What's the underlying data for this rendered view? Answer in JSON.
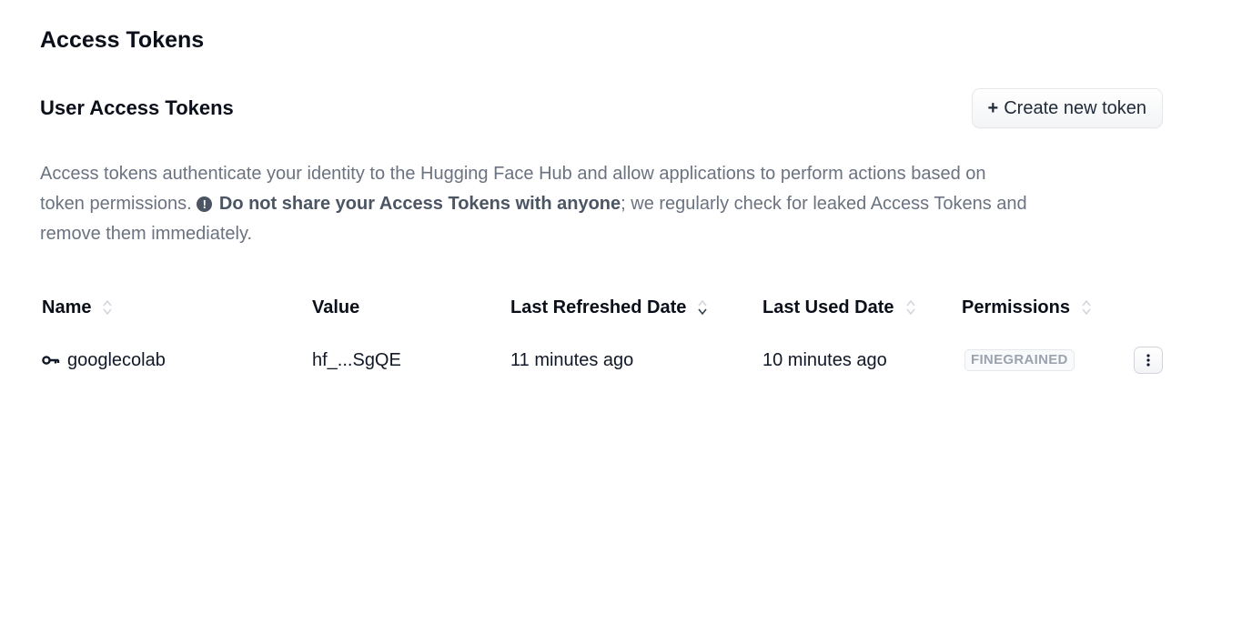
{
  "page": {
    "title": "Access Tokens"
  },
  "section": {
    "title": "User Access Tokens",
    "create_button_label": "Create new token",
    "create_button_icon": "plus-icon"
  },
  "description": {
    "part1": "Access tokens authenticate your identity to the Hugging Face Hub and allow applications to perform actions based on token permissions.",
    "warning_icon": "exclamation-circle-icon",
    "bold_prefix": "Do not share your",
    "bold_emphasis": "Access Tokens",
    "bold_suffix": "with anyone",
    "part2": "; we regularly check for leaked Access Tokens and remove them immediately."
  },
  "table": {
    "columns": {
      "name": "Name",
      "value": "Value",
      "last_refreshed": "Last Refreshed Date",
      "last_used": "Last Used Date",
      "permissions": "Permissions"
    },
    "rows": [
      {
        "icon": "key-icon",
        "name": "googlecolab",
        "value": "hf_...SgQE",
        "last_refreshed": "11 minutes ago",
        "last_used": "10 minutes ago",
        "permissions": "FINEGRAINED",
        "menu_icon": "more-vertical-icon"
      }
    ]
  },
  "colors": {
    "text_primary": "#0b0f19",
    "text_muted": "#6b7280",
    "badge_text": "#9ca3af",
    "border": "#e5e7eb"
  }
}
